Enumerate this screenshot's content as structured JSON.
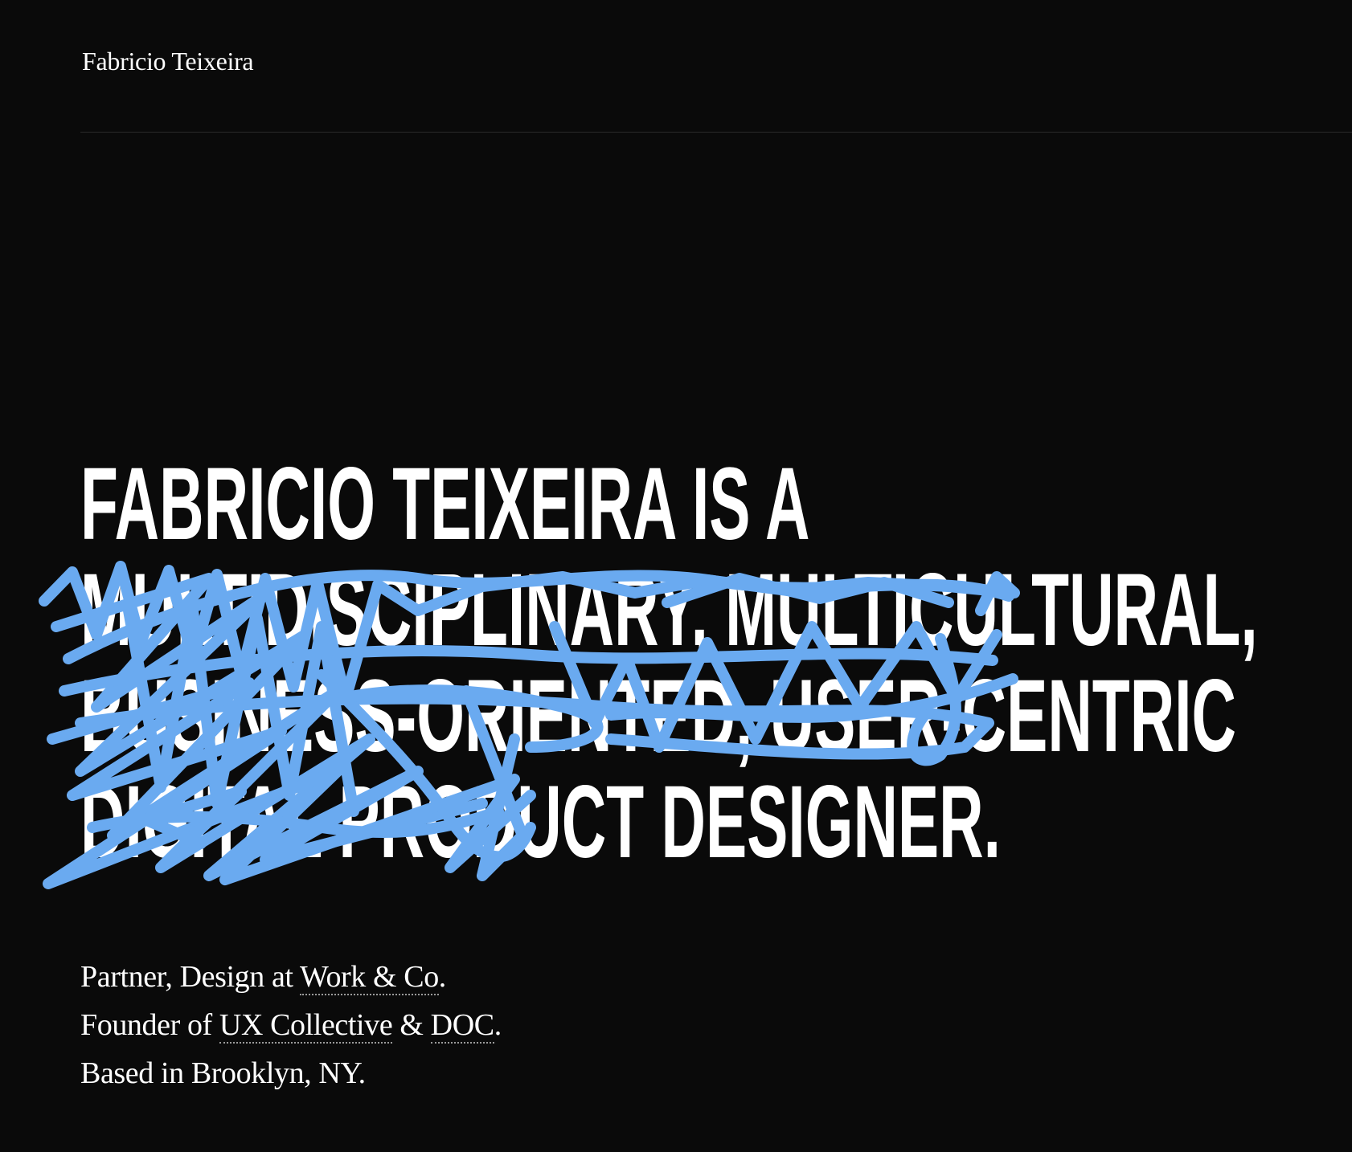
{
  "header": {
    "site_name": "Fabricio Teixeira"
  },
  "hero": {
    "line1": "Fabricio Teixeira is a",
    "line2": "multidisciplinary, multicultural,",
    "line3": "business-oriented, user-centric",
    "line4": "digital product designer."
  },
  "bio": {
    "role_prefix": "Partner, Design at ",
    "company_link": "Work & Co",
    "role_suffix": ".",
    "founder_prefix": "Founder of ",
    "uxc_link": "UX Collective",
    "amp": " & ",
    "doc_link": "DOC",
    "founder_suffix": ".",
    "location": "Based in Brooklyn, NY."
  },
  "colors": {
    "background": "#0a0a0a",
    "text": "#ffffff",
    "scribble": "#6aaaf0"
  }
}
